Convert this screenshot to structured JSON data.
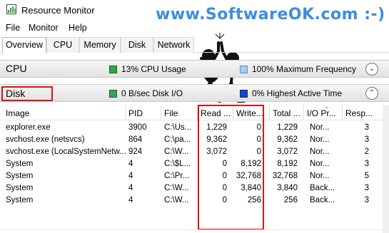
{
  "window": {
    "title": "Resource Monitor",
    "watermark": "www.SoftwareOK.com :-)"
  },
  "menu": [
    "File",
    "Monitor",
    "Help"
  ],
  "tabs": [
    "Overview",
    "CPU",
    "Memory",
    "Disk",
    "Network"
  ],
  "cpu_section": {
    "title": "CPU",
    "usage": "13% CPU Usage",
    "frequency": "100% Maximum Frequency",
    "expander": "⌄"
  },
  "disk_section": {
    "title": "Disk",
    "io": "0 B/sec Disk I/O",
    "active_time": "0% Highest Active Time",
    "expander": "⌃"
  },
  "table": {
    "columns": [
      "Image",
      "PID",
      "File",
      "Read ...",
      "Write...",
      "Total ...",
      "I/O Pr...",
      "Resp..."
    ],
    "rows": [
      [
        "explorer.exe",
        "3900",
        "C:\\Us...",
        "1,229",
        "0",
        "1,229",
        "Nor...",
        "3"
      ],
      [
        "svchost.exe (netsvcs)",
        "864",
        "C:\\pa...",
        "9,362",
        "0",
        "9,362",
        "Nor...",
        "3"
      ],
      [
        "svchost.exe (LocalSystemNetw...",
        "924",
        "C:\\W...",
        "3,072",
        "0",
        "3,072",
        "Nor...",
        "2"
      ],
      [
        "System",
        "4",
        "C:\\$L...",
        "0",
        "8,192",
        "8,192",
        "Nor...",
        "3"
      ],
      [
        "System",
        "4",
        "C:\\Pr...",
        "0",
        "32,768",
        "32,768",
        "Nor...",
        "5"
      ],
      [
        "System",
        "4",
        "C:\\W...",
        "0",
        "3,840",
        "3,840",
        "Back...",
        "3"
      ],
      [
        "System",
        "4",
        "C:\\W...",
        "0",
        "256",
        "256",
        "Back...",
        "3"
      ]
    ]
  },
  "colors": {
    "highlight": "#e31010",
    "watermark": "#3b8de0"
  }
}
